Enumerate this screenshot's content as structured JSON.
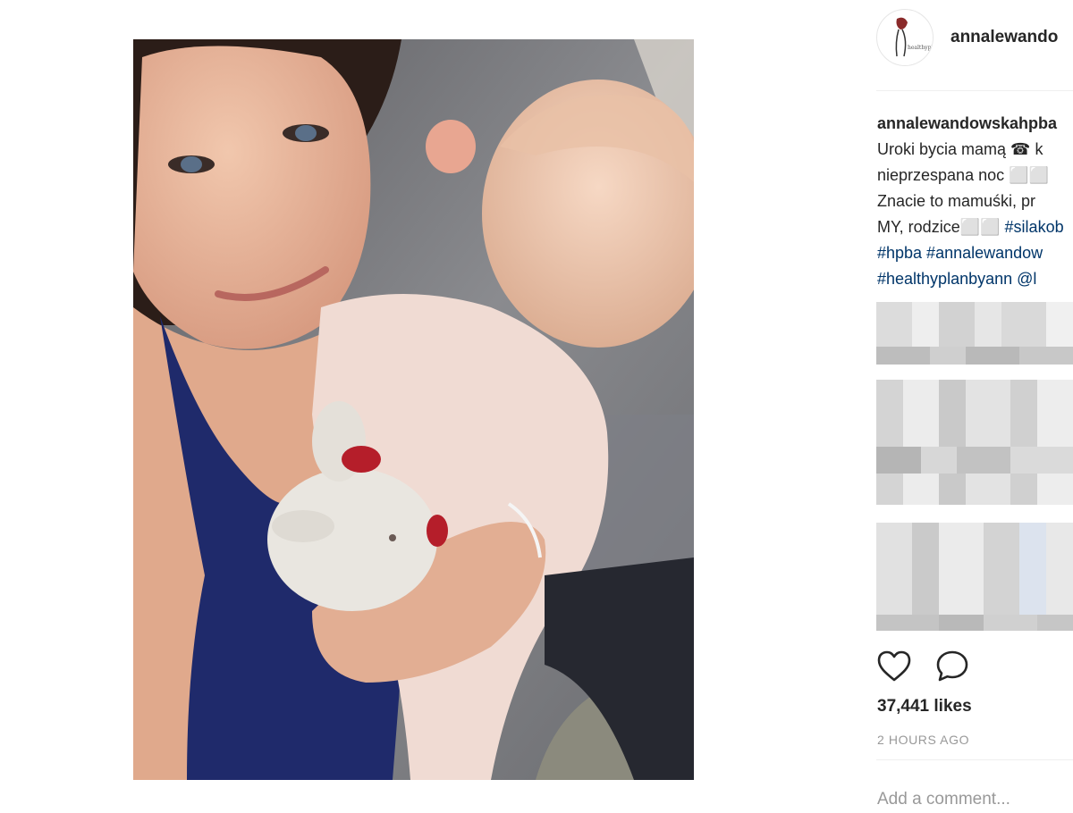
{
  "post": {
    "username": "annalewandowskahpba",
    "username_short": "annalewando",
    "avatar_text": "healthyplanbyann",
    "photo": "post-photo"
  },
  "caption": {
    "username": "annalewandowskahpba",
    "line1": "Uroki bycia mamą ☎ k",
    "line2": "nieprzespana noc ⬜⬜",
    "line3": "Znacie to mamuśki, pr",
    "line4_text": "MY, rodzice⬜⬜ ",
    "line4_tag": "#silakob",
    "line5": "#hpba #annalewandow",
    "line6": "#healthyplanbyann @l"
  },
  "actions": {
    "like_icon": "heart-icon",
    "comment_icon": "speech-bubble-icon",
    "likes_label": "37,441 likes",
    "time_label": "2 HOURS AGO"
  },
  "comment": {
    "placeholder": "Add a comment..."
  },
  "colors": {
    "text": "#262626",
    "hashtag": "#003569",
    "muted": "#999999",
    "divider": "#efefef"
  }
}
